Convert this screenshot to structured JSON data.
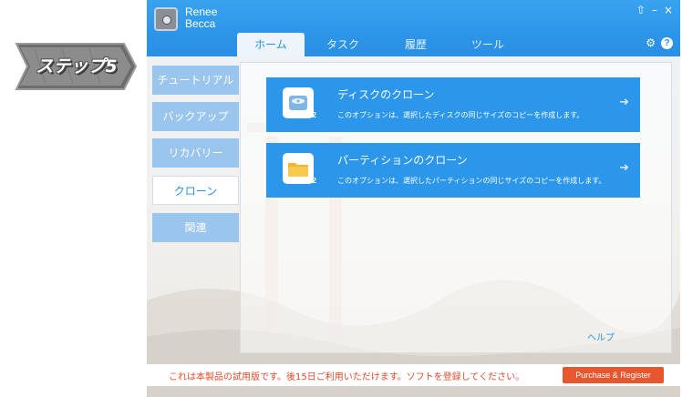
{
  "step_badge": {
    "label": "ステップ5"
  },
  "app": {
    "title_line1": "Renee",
    "title_line2": "Becca",
    "window_controls": [
      "⇧",
      "–",
      "×"
    ],
    "tabs": [
      {
        "label": "ホーム",
        "active": true
      },
      {
        "label": "タスク",
        "active": false
      },
      {
        "label": "履歴",
        "active": false
      },
      {
        "label": "ツール",
        "active": false
      }
    ],
    "sidebar": [
      {
        "label": "チュートリアル",
        "active": false
      },
      {
        "label": "バックアップ",
        "active": false
      },
      {
        "label": "リカバリー",
        "active": false
      },
      {
        "label": "クローン",
        "active": true
      },
      {
        "label": "関連",
        "active": false
      }
    ],
    "cards": [
      {
        "title": "ディスクのクローン",
        "desc": "このオプションは、選択したディスクの同じサイズのコピーを作成します。",
        "icon": "disk-clone-icon",
        "badge": "x2"
      },
      {
        "title": "パーティションのクローン",
        "desc": "このオプションは、選択したパーティションの同じサイズのコピーを作成します。",
        "icon": "folder-clone-icon",
        "badge": "x2"
      }
    ],
    "help_link": "ヘルプ",
    "trial_text": "これは本製品の試用版です。後15日ご利用いただけます。ソフトを登録してください。",
    "register_button": "Purchase & Register"
  },
  "colors": {
    "accent": "#2a8fe3",
    "card": "#2b96ea",
    "register": "#e8562f",
    "trial_text": "#e04a2b"
  }
}
